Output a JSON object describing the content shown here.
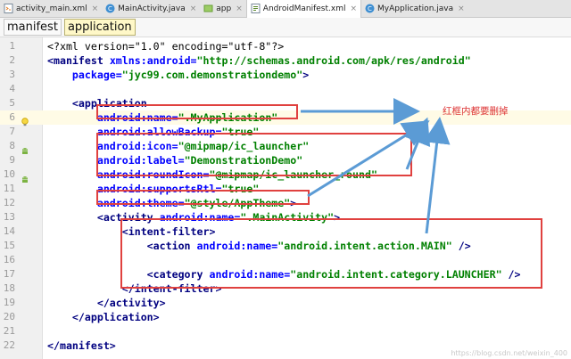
{
  "tabs": [
    {
      "label": "activity_main.xml",
      "icon": "xml-file-icon",
      "active": false
    },
    {
      "label": "MainActivity.java",
      "icon": "java-class-icon",
      "active": false
    },
    {
      "label": "app",
      "icon": "module-icon",
      "active": false
    },
    {
      "label": "AndroidManifest.xml",
      "icon": "manifest-file-icon",
      "active": true
    },
    {
      "label": "MyApplication.java",
      "icon": "java-class-icon",
      "active": false
    }
  ],
  "breadcrumb": [
    "manifest",
    "application"
  ],
  "editor": {
    "line_numbers": [
      "1",
      "2",
      "3",
      "4",
      "5",
      "6",
      "7",
      "8",
      "9",
      "10",
      "11",
      "12",
      "13",
      "14",
      "15",
      "16",
      "17",
      "18",
      "19",
      "20",
      "21",
      "22"
    ],
    "lines": [
      [
        {
          "c": "p",
          "v": "<?xml version=\"1.0\" encoding=\"utf-8\"?>"
        }
      ],
      [
        {
          "c": "t",
          "v": "<manifest "
        },
        {
          "c": "a",
          "v": "xmlns:android="
        },
        {
          "c": "s",
          "v": "\"http://schemas.android.com/apk/res/android\""
        }
      ],
      [
        {
          "c": "a",
          "v": "    package="
        },
        {
          "c": "s",
          "v": "\"jyc99.com.demonstrationdemo\""
        },
        {
          "c": "t",
          "v": ">"
        }
      ],
      [],
      [
        {
          "c": "t",
          "v": "    <application"
        }
      ],
      [
        {
          "c": "a",
          "v": "        android:name="
        },
        {
          "c": "s",
          "v": "\".MyApplication\""
        }
      ],
      [
        {
          "c": "a",
          "v": "        android:allowBackup="
        },
        {
          "c": "s",
          "v": "\"true\""
        }
      ],
      [
        {
          "c": "a",
          "v": "        android:icon="
        },
        {
          "c": "s",
          "v": "\"@mipmap/ic_launcher\""
        }
      ],
      [
        {
          "c": "a",
          "v": "        android:label="
        },
        {
          "c": "s",
          "v": "\"DemonstrationDemo\""
        }
      ],
      [
        {
          "c": "a",
          "v": "        android:roundIcon="
        },
        {
          "c": "s",
          "v": "\"@mipmap/ic_launcher_round\""
        }
      ],
      [
        {
          "c": "a",
          "v": "        android:supportsRtl="
        },
        {
          "c": "s",
          "v": "\"true\""
        }
      ],
      [
        {
          "c": "a",
          "v": "        android:theme="
        },
        {
          "c": "s",
          "v": "\"@style/AppTheme\""
        },
        {
          "c": "t",
          "v": ">"
        }
      ],
      [
        {
          "c": "t",
          "v": "        <activity "
        },
        {
          "c": "a",
          "v": "android:name="
        },
        {
          "c": "s",
          "v": "\".MainActivity\""
        },
        {
          "c": "t",
          "v": ">"
        }
      ],
      [
        {
          "c": "t",
          "v": "            <intent-filter>"
        }
      ],
      [
        {
          "c": "t",
          "v": "                <action "
        },
        {
          "c": "a",
          "v": "android:name="
        },
        {
          "c": "s",
          "v": "\"android.intent.action.MAIN\""
        },
        {
          "c": "t",
          "v": " />"
        }
      ],
      [],
      [
        {
          "c": "t",
          "v": "                <category "
        },
        {
          "c": "a",
          "v": "android:name="
        },
        {
          "c": "s",
          "v": "\"android.intent.category.LAUNCHER\""
        },
        {
          "c": "t",
          "v": " />"
        }
      ],
      [
        {
          "c": "t",
          "v": "            </intent-filter>"
        }
      ],
      [
        {
          "c": "t",
          "v": "        </activity>"
        }
      ],
      [
        {
          "c": "t",
          "v": "    </application>"
        }
      ],
      [],
      [
        {
          "c": "t",
          "v": "</manifest>"
        }
      ]
    ],
    "highlighted_line": "6",
    "gutter_marks": [
      {
        "line": "6",
        "icon": "lightbulb-icon"
      },
      {
        "line": "8",
        "icon": "android-icon"
      },
      {
        "line": "10",
        "icon": "android-icon"
      }
    ]
  },
  "annotation": {
    "text": "红框内都要删掉",
    "color": "#e0413f"
  },
  "watermark": "https://blog.csdn.net/weixin_400"
}
